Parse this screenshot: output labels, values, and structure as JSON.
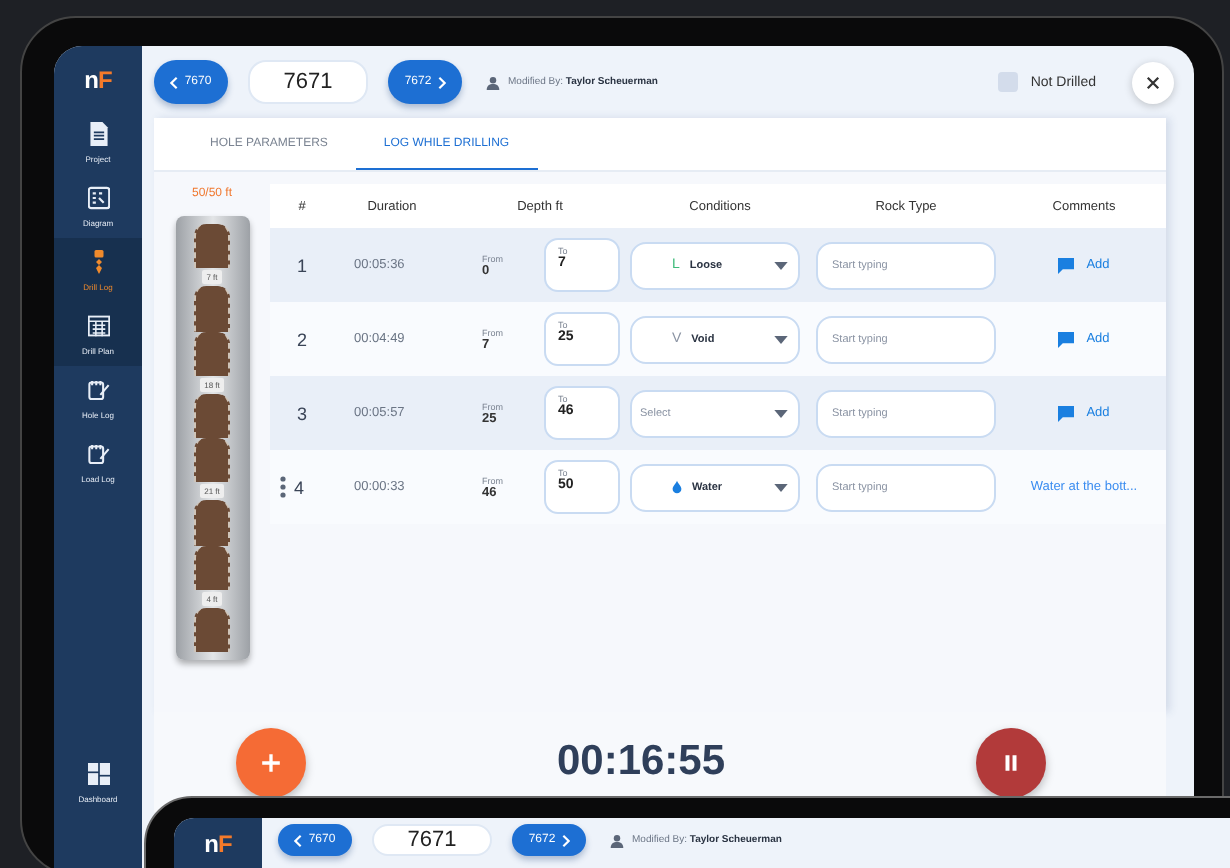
{
  "sidebar": {
    "logo": {
      "first": "n",
      "second": "F"
    },
    "items": [
      {
        "label": "Project",
        "selected": false,
        "grouped": false
      },
      {
        "label": "Diagram",
        "selected": false,
        "grouped": false
      },
      {
        "label": "Drill Log",
        "selected": true,
        "grouped": true
      },
      {
        "label": "Drill Plan",
        "selected": false,
        "grouped": true
      },
      {
        "label": "Hole Log",
        "selected": false,
        "grouped": false
      },
      {
        "label": "Load Log",
        "selected": false,
        "grouped": false
      }
    ],
    "bottom_item": {
      "label": "Dashboard"
    }
  },
  "header": {
    "prev": "7670",
    "current": "7671",
    "next": "7672",
    "modified_label": "Modified By:",
    "modified_by": "Taylor Scheuerman",
    "not_drilled": {
      "label": "Not Drilled",
      "checked": false
    }
  },
  "tabs": [
    {
      "label": "HOLE PARAMETERS",
      "selected": false
    },
    {
      "label": "LOG WHILE DRILLING",
      "selected": true
    }
  ],
  "core": {
    "reading": "50/50 ft",
    "labels": [
      "7 ft",
      "18 ft",
      "21 ft",
      "4 ft"
    ]
  },
  "table": {
    "columns": [
      "#",
      "Duration",
      "Depth ft",
      "Conditions",
      "Rock Type",
      "Comments"
    ],
    "rows": [
      {
        "number": "1",
        "duration": "00:05:36",
        "from_label": "From",
        "from": "0",
        "to_label": "To",
        "to": "7",
        "condition": {
          "kind": "letter",
          "symbol": "L",
          "color": "#3dbb7a",
          "value": "Loose"
        },
        "rock_type": {
          "placeholder": "Start typing"
        },
        "comment": {
          "kind": "add",
          "text": "Add"
        },
        "handle": false
      },
      {
        "number": "2",
        "duration": "00:04:49",
        "from_label": "From",
        "from": "7",
        "to_label": "To",
        "to": "25",
        "condition": {
          "kind": "letter",
          "symbol": "V",
          "color": "#8a93a3",
          "value": "Void"
        },
        "rock_type": {
          "placeholder": "Start typing"
        },
        "comment": {
          "kind": "add",
          "text": "Add"
        },
        "handle": false
      },
      {
        "number": "3",
        "duration": "00:05:57",
        "from_label": "From",
        "from": "25",
        "to_label": "To",
        "to": "46",
        "condition": {
          "kind": "empty",
          "placeholder": "Select"
        },
        "rock_type": {
          "placeholder": "Start typing"
        },
        "comment": {
          "kind": "add",
          "text": "Add"
        },
        "handle": false
      },
      {
        "number": "4",
        "duration": "00:00:33",
        "from_label": "From",
        "from": "46",
        "to_label": "To",
        "to": "50",
        "condition": {
          "kind": "drop",
          "value": "Water"
        },
        "rock_type": {
          "placeholder": "Start typing"
        },
        "comment": {
          "kind": "text",
          "text": "Water at the bott..."
        },
        "handle": true
      }
    ]
  },
  "timer": "00:16:55",
  "second_device": {
    "logo": {
      "first": "n",
      "second": "F"
    },
    "prev": "7670",
    "current": "7671",
    "next": "7672",
    "modified_label": "Modified By:",
    "modified_by": "Taylor Scheuerman"
  }
}
